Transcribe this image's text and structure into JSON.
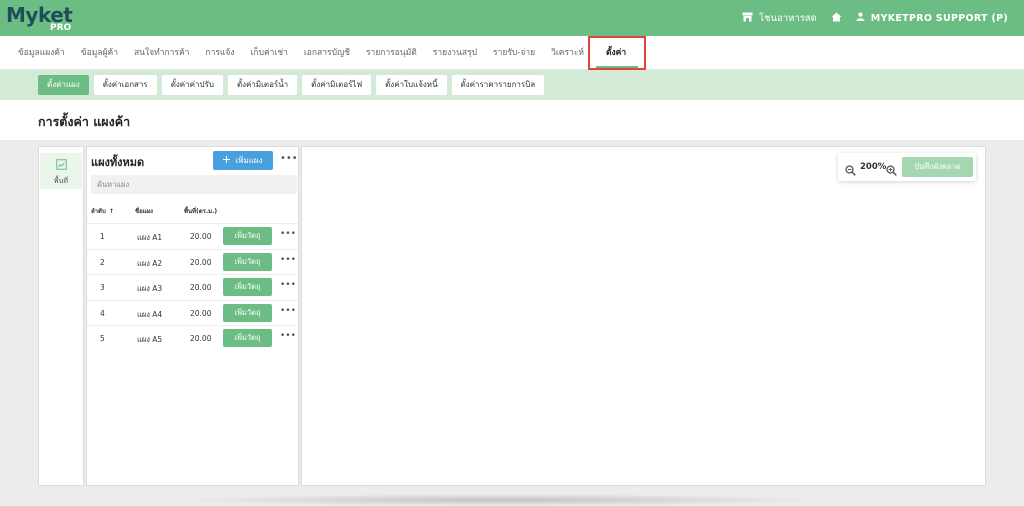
{
  "brand": {
    "name": "Myket",
    "sub": "PRO"
  },
  "topbar": {
    "shop_label": "โชนอาหารสด",
    "user_label": "MYKETPRO SUPPORT (P)"
  },
  "main_tabs": [
    {
      "label": "ข้อมูลแผงค้า"
    },
    {
      "label": "ข้อมูลผู้ค้า"
    },
    {
      "label": "สนใจทำการค้า"
    },
    {
      "label": "การแจ้ง"
    },
    {
      "label": "เก็บค่าเช่า"
    },
    {
      "label": "เอกสารบัญชี"
    },
    {
      "label": "รายการอนุมัติ"
    },
    {
      "label": "รายงานสรุป"
    },
    {
      "label": "รายรับ-จ่าย"
    },
    {
      "label": "วิเคราะห์"
    },
    {
      "label": "ตั้งค่า"
    }
  ],
  "sub_tabs": [
    {
      "label": "ตั้งค่าแผง"
    },
    {
      "label": "ตั้งค่าเอกสาร"
    },
    {
      "label": "ตั้งค่าค่าปรับ"
    },
    {
      "label": "ตั้งค่ามิเตอร์น้ำ"
    },
    {
      "label": "ตั้งค่ามิเตอร์ไฟ"
    },
    {
      "label": "ตั้งค่าใบแจ้งหนี้"
    },
    {
      "label": "ตั้งค่าราคารายการบิล"
    }
  ],
  "page": {
    "title": "การตั้งค่า แผงค้า"
  },
  "sidebar": {
    "item_label": "พื้นที่"
  },
  "list_panel": {
    "title": "แผงทั้งหมด",
    "add_label": "เพิ่มแผง",
    "search_placeholder": "ค้นหาแผง",
    "columns": {
      "order": "ลำดับ",
      "name": "ชื่อแผง",
      "area": "พื้นที่(ตร.ม.)"
    },
    "row_button": "เพิ่มวัตถุ",
    "rows": [
      {
        "no": "1",
        "name": "แผง A1",
        "area": "20.00"
      },
      {
        "no": "2",
        "name": "แผง A2",
        "area": "20.00"
      },
      {
        "no": "3",
        "name": "แผง A3",
        "area": "20.00"
      },
      {
        "no": "4",
        "name": "แผง A4",
        "area": "20.00"
      },
      {
        "no": "5",
        "name": "แผง A5",
        "area": "20.00"
      }
    ]
  },
  "canvas": {
    "zoom_level": "200%",
    "save_label": "บันทึกผังตลาด"
  },
  "colors": {
    "brand_green": "#6cbd84",
    "subnav_bg": "#d2ead6",
    "add_blue": "#4aa0de",
    "highlight_red": "#e0443e"
  }
}
